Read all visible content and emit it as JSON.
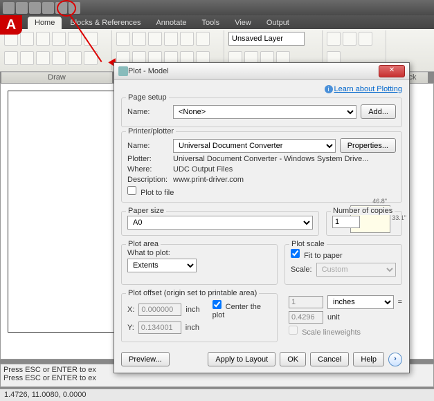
{
  "titlebar_icons": [
    "new",
    "open",
    "save",
    "print",
    "undo",
    "redo"
  ],
  "logo": "A",
  "ribbon": {
    "tabs": [
      "Home",
      "Blocks & References",
      "Annotate",
      "Tools",
      "View",
      "Output"
    ],
    "active_tab": 0,
    "layer_combo": "Unsaved Layer",
    "panel1_label": "Draw",
    "block_label": "Block"
  },
  "dlg": {
    "title": "Plot - Model",
    "learn_link": "Learn about Plotting",
    "page_setup": {
      "legend": "Page setup",
      "name_lbl": "Name:",
      "name_val": "<None>",
      "add_btn": "Add..."
    },
    "printer": {
      "legend": "Printer/plotter",
      "name_lbl": "Name:",
      "name_val": "Universal Document Converter",
      "props_btn": "Properties...",
      "plotter_lbl": "Plotter:",
      "plotter_val": "Universal Document Converter - Windows System Drive...",
      "where_lbl": "Where:",
      "where_val": "UDC Output Files",
      "desc_lbl": "Description:",
      "desc_val": "www.print-driver.com",
      "plot_to_file": "Plot to file"
    },
    "paper": {
      "legend": "Paper size",
      "val": "A0",
      "copies_legend": "Number of copies",
      "copies_val": "1"
    },
    "plotarea": {
      "legend": "Plot area",
      "what_lbl": "What to plot:",
      "what_val": "Extents"
    },
    "plotscale": {
      "legend": "Plot scale",
      "fit": "Fit to paper",
      "scale_lbl": "Scale:",
      "scale_val": "Custom",
      "unit_val": "1",
      "unit_sel": "inches",
      "unit2_val": "0.4296",
      "unit2_lbl": "unit",
      "linewt": "Scale lineweights"
    },
    "offset": {
      "legend": "Plot offset (origin set to printable area)",
      "x_lbl": "X:",
      "x_val": "0.000000",
      "y_lbl": "Y:",
      "y_val": "0.134001",
      "inch": "inch",
      "center": "Center the plot"
    },
    "buttons": {
      "preview": "Preview...",
      "apply": "Apply to Layout",
      "ok": "OK",
      "cancel": "Cancel",
      "help": "Help"
    }
  },
  "cmdline": {
    "l1": "Press ESC or ENTER to ex",
    "l2": "Press ESC or ENTER to ex"
  },
  "status": "1.4726, 11.0080, 0.0000"
}
